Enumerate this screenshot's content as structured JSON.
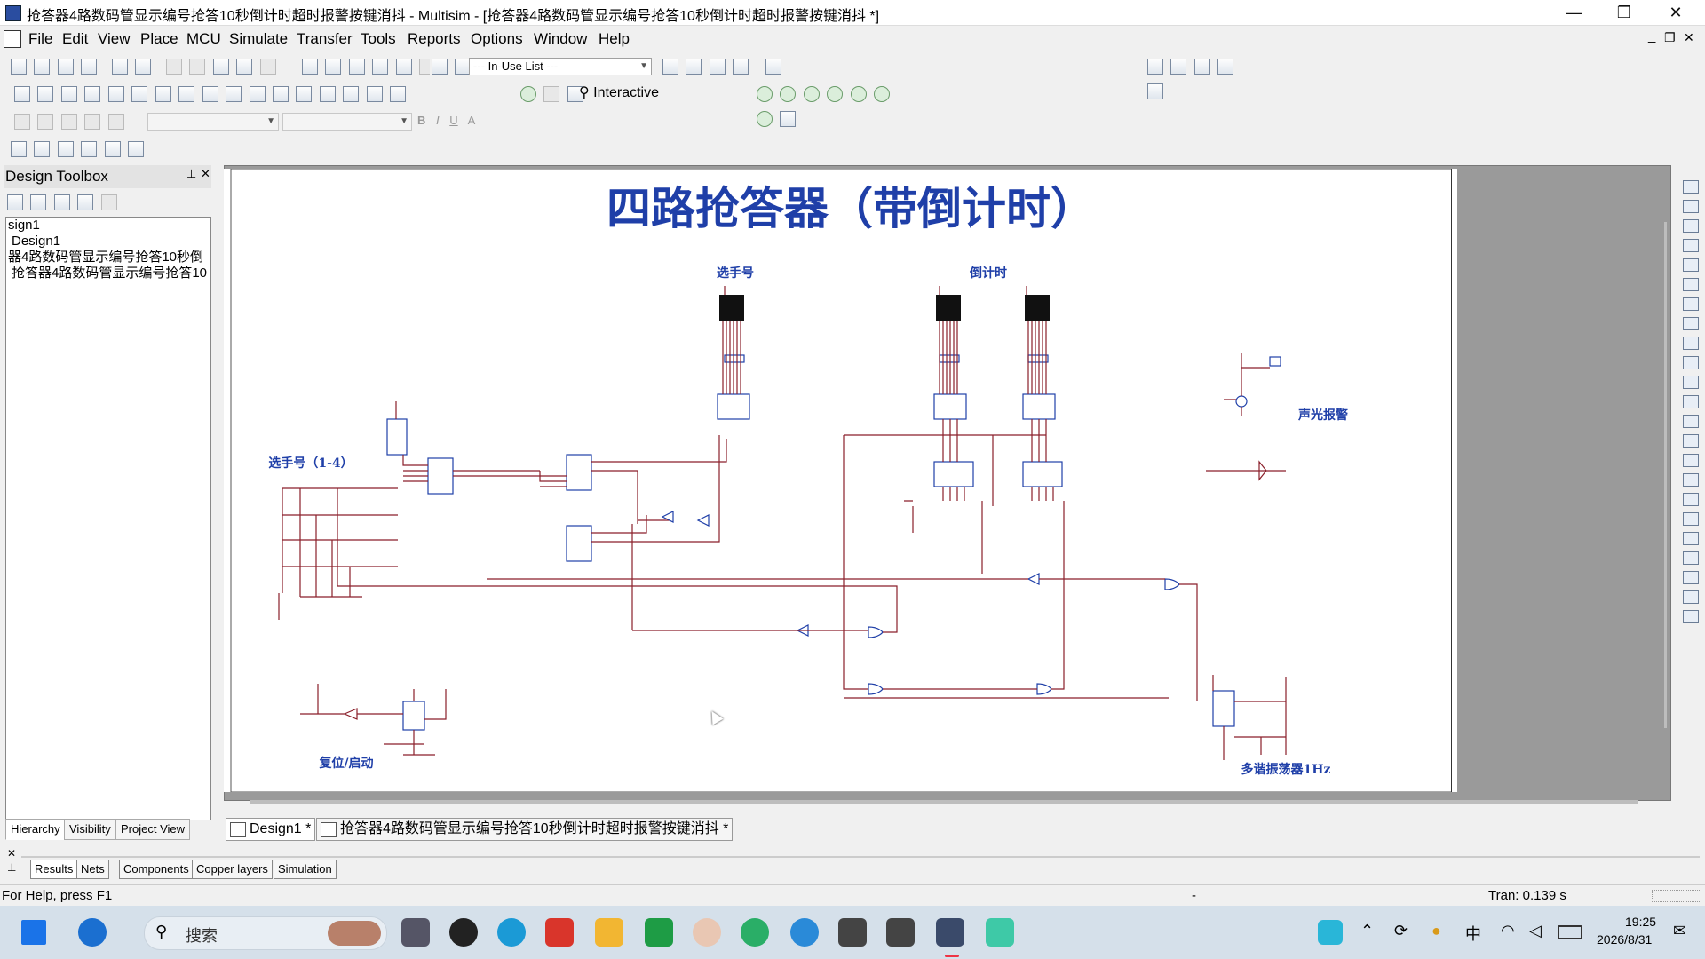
{
  "window": {
    "title": "抢答器4路数码管显示编号抢答10秒倒计时超时报警按键消抖 - Multisim - [抢答器4路数码管显示编号抢答10秒倒计时超时报警按键消抖 *]",
    "minimize_glyph": "—",
    "restore_glyph": "❐",
    "close_glyph": "✕"
  },
  "menu": {
    "items": [
      {
        "label": "File"
      },
      {
        "label": "Edit"
      },
      {
        "label": "View"
      },
      {
        "label": "Place"
      },
      {
        "label": "MCU"
      },
      {
        "label": "Simulate"
      },
      {
        "label": "Transfer"
      },
      {
        "label": "Tools"
      },
      {
        "label": "Reports"
      },
      {
        "label": "Options"
      },
      {
        "label": "Window"
      },
      {
        "label": "Help"
      }
    ],
    "mdi_buttons": [
      "_",
      "❐",
      "✕"
    ]
  },
  "toolbar": {
    "in_use_list": "--- In-Use List ---",
    "interactive_label": "Interactive",
    "format_buttons": [
      "B",
      "I",
      "U",
      "A"
    ]
  },
  "design_toolbox": {
    "title": "Design Toolbox",
    "tree": [
      "sign1",
      "Design1",
      "器4路数码管显示编号抢答10秒倒",
      "抢答器4路数码管显示编号抢答10"
    ],
    "tabs": [
      "Hierarchy",
      "Visibility",
      "Project View"
    ]
  },
  "schematic": {
    "title": "四路抢答器（带倒计时）",
    "labels": {
      "player_display": "选手号",
      "countdown": "倒计时",
      "player_inputs": "选手号（1-4）",
      "alarm": "声光报警",
      "reset": "复位/启动",
      "oscillator": "多谐振荡器1Hz"
    }
  },
  "doc_tabs": [
    {
      "label": "Design1 *"
    },
    {
      "label": "抢答器4路数码管显示编号抢答10秒倒计时超时报警按键消抖 *"
    }
  ],
  "spreadsheet_tabs": [
    "Results",
    "Nets",
    "Components",
    "Copper layers",
    "Simulation"
  ],
  "status": {
    "help": "For Help, press F1",
    "middle": "-",
    "tran": "Tran: 0.139 s"
  },
  "taskbar": {
    "search_placeholder": "搜索",
    "ime": "中",
    "time": "19:25",
    "date": "2026/8/31",
    "colors": {
      "start": "#1a73e8",
      "edge": "#1b6fd0",
      "wps": "#d9352b",
      "folder": "#f2b632",
      "wechat": "#2aae67"
    }
  }
}
